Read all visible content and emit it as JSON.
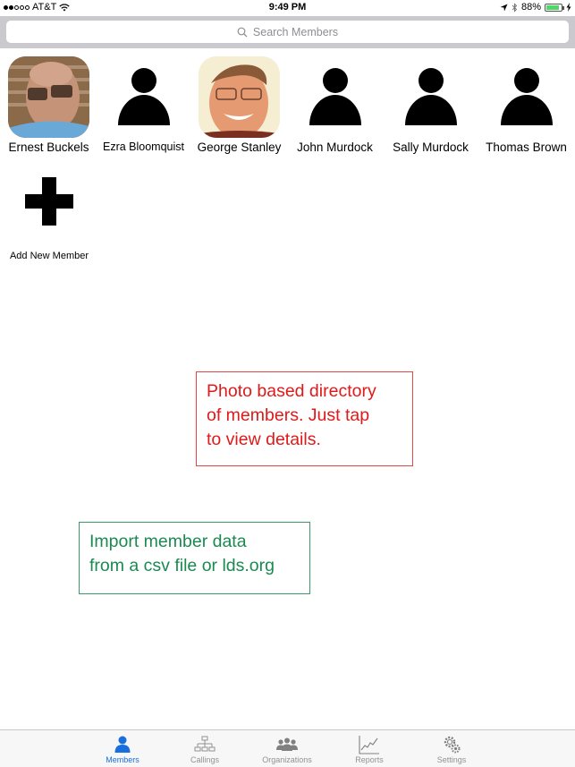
{
  "status_bar": {
    "carrier": "AT&T",
    "signal_bars_filled": 2,
    "signal_bars_total": 5,
    "time": "9:49 PM",
    "battery_percent": "88%",
    "battery_level": 0.88
  },
  "search": {
    "placeholder": "Search Members"
  },
  "members": [
    {
      "name": "Ernest Buckels",
      "avatar": "photo"
    },
    {
      "name": "Ezra Bloomquist",
      "avatar": "person-silhouette-icon"
    },
    {
      "name": "George Stanley",
      "avatar": "photo"
    },
    {
      "name": "John Murdock",
      "avatar": "person-silhouette-icon"
    },
    {
      "name": "Sally Murdock",
      "avatar": "person-silhouette-icon"
    },
    {
      "name": "Thomas Brown",
      "avatar": "person-silhouette-icon"
    }
  ],
  "add_member": {
    "label": "Add New Member",
    "icon": "plus-icon"
  },
  "callouts": {
    "red": {
      "lines": [
        "Photo based directory",
        "of members. Just tap",
        "to view details."
      ],
      "color": "#e01919"
    },
    "green": {
      "lines": [
        "Import member data",
        "from a csv file or lds.org"
      ],
      "color": "#1a8a50"
    }
  },
  "tab_bar": {
    "tabs": [
      {
        "label": "Members",
        "icon": "person-icon",
        "active": true
      },
      {
        "label": "Callings",
        "icon": "org-chart-icon",
        "active": false
      },
      {
        "label": "Organizations",
        "icon": "group-icon",
        "active": false
      },
      {
        "label": "Reports",
        "icon": "line-chart-icon",
        "active": false
      },
      {
        "label": "Settings",
        "icon": "gears-icon",
        "active": false
      }
    ],
    "active_color": "#1a6fe0",
    "inactive_color": "#929292"
  }
}
